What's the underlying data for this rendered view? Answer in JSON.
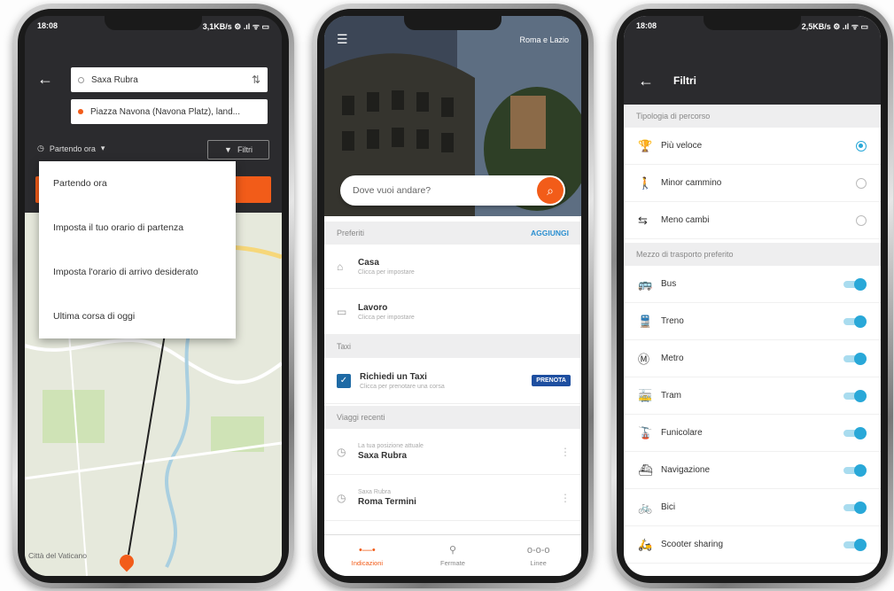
{
  "colors": {
    "accent": "#f25c19",
    "toggle": "#29a8d8",
    "dark_header": "#2b2b2e"
  },
  "phone1": {
    "status_time": "18:08",
    "status_right": "3,1KB/s ⚙ .ıl ᯤ ▭",
    "origin": "Saxa Rubra",
    "destination": "Piazza Navona (Navona Platz), land...",
    "swap_icon": "swap-icon",
    "time_label": "Partendo ora",
    "filter_label": "Filtri",
    "dropdown_options": [
      "Partendo ora",
      "Imposta il tuo orario di partenza",
      "Imposta l'orario di arrivo desiderato",
      "Ultima corsa di oggi"
    ],
    "map_label": "Città del Vaticano"
  },
  "phone2": {
    "city": "Roma e Lazio",
    "search_placeholder": "Dove vuoi andare?",
    "favorites_header": "Preferiti",
    "favorites_action": "AGGIUNGI",
    "favorites": [
      {
        "title": "Casa",
        "subtitle": "Clicca per impostare"
      },
      {
        "title": "Lavoro",
        "subtitle": "Clicca per impostare"
      }
    ],
    "taxi_header": "Taxi",
    "taxi_title": "Richiedi un Taxi",
    "taxi_subtitle": "Clicca per prenotare una corsa",
    "taxi_button": "PRENOTA",
    "recent_header": "Viaggi recenti",
    "recent": [
      {
        "from": "La tua posizione attuale",
        "to": "Saxa Rubra"
      },
      {
        "from": "Saxa Rubra",
        "to": "Roma Termini"
      }
    ],
    "nav": [
      {
        "label": "Indicazioni",
        "glyph": "•—•"
      },
      {
        "label": "Fermate",
        "glyph": "⚲"
      },
      {
        "label": "Linee",
        "glyph": "o-o-o"
      }
    ]
  },
  "phone3": {
    "status_time": "18:08",
    "status_right": "2,5KB/s ⚙ .ıl ᯤ ▭",
    "title": "Filtri",
    "route_header": "Tipologia di percorso",
    "route_options": [
      {
        "label": "Più veloce",
        "icon": "trophy-icon",
        "glyph": "🏆",
        "selected": true
      },
      {
        "label": "Minor cammino",
        "icon": "walk-icon",
        "glyph": "🚶",
        "selected": false
      },
      {
        "label": "Meno cambi",
        "icon": "transfer-icon",
        "glyph": "⇆",
        "selected": false
      }
    ],
    "transport_header": "Mezzo di trasporto preferito",
    "transports": [
      {
        "label": "Bus",
        "icon": "bus-icon",
        "glyph": "🚌",
        "on": true
      },
      {
        "label": "Treno",
        "icon": "train-icon",
        "glyph": "🚆",
        "on": true
      },
      {
        "label": "Metro",
        "icon": "metro-icon",
        "glyph": "Ⓜ",
        "on": true
      },
      {
        "label": "Tram",
        "icon": "tram-icon",
        "glyph": "🚋",
        "on": true
      },
      {
        "label": "Funicolare",
        "icon": "funicular-icon",
        "glyph": "🚡",
        "on": true
      },
      {
        "label": "Navigazione",
        "icon": "boat-icon",
        "glyph": "⛴",
        "on": true
      },
      {
        "label": "Bici",
        "icon": "bike-icon",
        "glyph": "🚲",
        "on": true
      },
      {
        "label": "Scooter sharing",
        "icon": "scooter-icon",
        "glyph": "🛵",
        "on": true
      }
    ]
  }
}
